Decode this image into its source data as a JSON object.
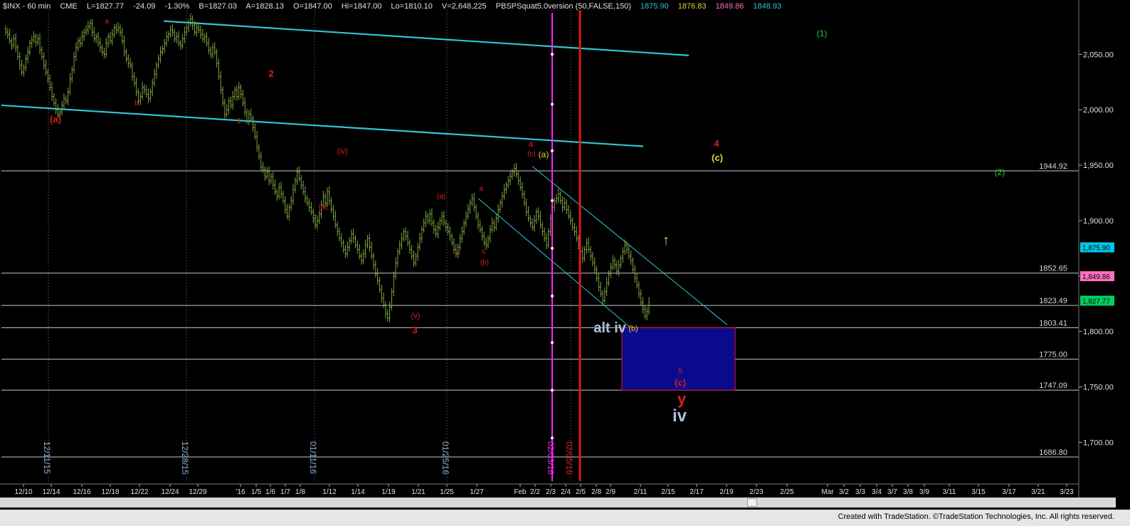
{
  "header": {
    "symbol": "$INX - 60 min",
    "exchange": "CME",
    "last": "L=1827.77",
    "change": "-24.09",
    "change_pct": "-1.30%",
    "bid": "B=1827.03",
    "ask": "A=1828.13",
    "open": "O=1847.00",
    "high": "Hi=1847.00",
    "low": "Lo=1810.10",
    "volume": "V=2,648,225",
    "study": "PBSPSquat5.0version (50,FALSE,150)",
    "study_v1": "1875.90",
    "study_v2": "1876.83",
    "study_v3": "1849.86",
    "study_v4": "1848.93"
  },
  "footer": {
    "credit": "Created with TradeStation. ©TradeStation Technologies, Inc. All rights reserved."
  },
  "colors": {
    "background": "#000000",
    "candle": "#7fa63e",
    "channel": "#2ec4d6",
    "hline": "#c8c8c8",
    "wave_red": "#d62020",
    "wave_yellow": "#e8d23a",
    "wave_green": "#2ecc2e",
    "wave_blue": "#aebfd9",
    "magenta": "#ff22ff",
    "box_fill": "#0a0a8c",
    "box_edge": "#e02020",
    "tag_green": "#00d060",
    "tag_pink": "#ff70c0",
    "tag_cyan": "#00c8e8"
  },
  "chart_data": {
    "type": "candlestick",
    "y_ticks": [
      {
        "value": 2050,
        "label": "2,050.00"
      },
      {
        "value": 2000,
        "label": "2,000.00"
      },
      {
        "value": 1950,
        "label": "1,950.00"
      },
      {
        "value": 1900,
        "label": "1,900.00"
      },
      {
        "value": 1850,
        "label": "1,850.00"
      },
      {
        "value": 1800,
        "label": "1,800.00"
      },
      {
        "value": 1750,
        "label": "1,750.00"
      },
      {
        "value": 1700,
        "label": "1,700.00"
      }
    ],
    "ylim": [
      1665,
      2090
    ],
    "x_ticks": [
      "12/10",
      "12/14",
      "12/16",
      "12/18",
      "12/22",
      "12/24",
      "12/29",
      "'16",
      "1/5",
      "1/6",
      "1/7",
      "1/8",
      "1/12",
      "1/14",
      "1/19",
      "1/21",
      "1/25",
      "1/27",
      "Feb",
      "2/2",
      "2/3",
      "2/4",
      "2/5",
      "2/8",
      "2/9",
      "2/11",
      "2/15",
      "2/17",
      "2/19",
      "2/23",
      "2/25",
      "Mar",
      "3/2",
      "3/3",
      "3/4",
      "3/7",
      "3/8",
      "3/9",
      "3/11",
      "3/15",
      "3/17",
      "3/21",
      "3/23"
    ],
    "vertical_date_labels": [
      "12/11/15",
      "12/28/15",
      "01/11/16",
      "01/25/16",
      "02/03/16",
      "02/05/16"
    ],
    "horizontal_levels": [
      {
        "value": 1944.92,
        "label": "1944.92"
      },
      {
        "value": 1852.65,
        "label": "1852.65"
      },
      {
        "value": 1823.49,
        "label": "1823.49"
      },
      {
        "value": 1803.41,
        "label": "1803.41"
      },
      {
        "value": 1775.0,
        "label": "1775.00"
      },
      {
        "value": 1747.09,
        "label": "1747.09"
      },
      {
        "value": 1686.8,
        "label": "1686.80"
      }
    ],
    "price_tags": [
      {
        "value": 1875.9,
        "label": "1,875.90",
        "color": "tag_cyan"
      },
      {
        "value": 1849.86,
        "label": "1,849.86",
        "color": "tag_pink"
      },
      {
        "value": 1827.77,
        "label": "1,827.77",
        "color": "tag_green"
      }
    ],
    "closes": [
      2070,
      2068,
      2062,
      2058,
      2064,
      2056,
      2048,
      2040,
      2034,
      2038,
      2046,
      2052,
      2060,
      2063,
      2066,
      2061,
      2064,
      2054,
      2048,
      2040,
      2034,
      2028,
      2020,
      2012,
      2006,
      2000,
      1996,
      1998,
      2004,
      2010,
      2008,
      2016,
      2028,
      2036,
      2048,
      2056,
      2062,
      2060,
      2066,
      2070,
      2072,
      2075,
      2078,
      2070,
      2064,
      2066,
      2060,
      2056,
      2052,
      2050,
      2060,
      2066,
      2062,
      2068,
      2074,
      2072,
      2074,
      2070,
      2062,
      2052,
      2046,
      2042,
      2040,
      2030,
      2024,
      2016,
      2008,
      2012,
      2020,
      2018,
      2014,
      2010,
      2016,
      2024,
      2032,
      2040,
      2046,
      2052,
      2055,
      2060,
      2066,
      2068,
      2072,
      2070,
      2064,
      2066,
      2060,
      2058,
      2064,
      2070,
      2074,
      2078,
      2082,
      2076,
      2070,
      2074,
      2072,
      2068,
      2064,
      2066,
      2060,
      2054,
      2050,
      2056,
      2052,
      2042,
      2030,
      2018,
      2006,
      1996,
      2000,
      2008,
      2004,
      2012,
      2018,
      2012,
      2020,
      2014,
      2006,
      1998,
      1990,
      1996,
      1992,
      1984,
      1976,
      1966,
      1958,
      1948,
      1946,
      1940,
      1944,
      1936,
      1940,
      1932,
      1926,
      1922,
      1930,
      1924,
      1918,
      1910,
      1904,
      1912,
      1918,
      1928,
      1936,
      1944,
      1938,
      1932,
      1926,
      1920,
      1916,
      1912,
      1908,
      1902,
      1896,
      1900,
      1906,
      1914,
      1922,
      1916,
      1926,
      1918,
      1910,
      1904,
      1896,
      1890,
      1884,
      1880,
      1874,
      1870,
      1876,
      1882,
      1888,
      1884,
      1878,
      1874,
      1868,
      1864,
      1870,
      1878,
      1884,
      1876,
      1868,
      1860,
      1852,
      1846,
      1838,
      1830,
      1824,
      1816,
      1812,
      1822,
      1836,
      1850,
      1862,
      1872,
      1878,
      1884,
      1890,
      1886,
      1880,
      1874,
      1868,
      1862,
      1868,
      1876,
      1884,
      1892,
      1898,
      1904,
      1900,
      1906,
      1898,
      1892,
      1888,
      1894,
      1900,
      1904,
      1898,
      1894,
      1890,
      1886,
      1880,
      1874,
      1870,
      1876,
      1884,
      1890,
      1898,
      1904,
      1910,
      1916,
      1920,
      1912,
      1904,
      1896,
      1892,
      1886,
      1880,
      1878,
      1884,
      1892,
      1898,
      1894,
      1902,
      1910,
      1916,
      1922,
      1928,
      1932,
      1936,
      1940,
      1944,
      1947,
      1942,
      1936,
      1930,
      1924,
      1916,
      1908,
      1902,
      1898,
      1894,
      1900,
      1908,
      1904,
      1896,
      1890,
      1884,
      1878,
      1890,
      1902,
      1912,
      1918,
      1920,
      1924,
      1918,
      1912,
      1916,
      1910,
      1904,
      1900,
      1894,
      1890,
      1884,
      1878,
      1872,
      1866,
      1874,
      1880,
      1874,
      1868,
      1862,
      1856,
      1848,
      1840,
      1834,
      1828,
      1836,
      1844,
      1852,
      1858,
      1864,
      1860,
      1854,
      1860,
      1866,
      1872,
      1878,
      1874,
      1868,
      1864,
      1856,
      1848,
      1842,
      1834,
      1826,
      1820,
      1814,
      1818,
      1826
    ]
  },
  "annotations": [
    {
      "text": "a",
      "color": "wave_red"
    },
    {
      "text": "(a)",
      "color": "wave_red"
    },
    {
      "text": "b",
      "color": "wave_red"
    },
    {
      "text": "1",
      "color": "wave_red"
    },
    {
      "text": "2",
      "color": "wave_red"
    },
    {
      "text": "(iv)",
      "color": "wave_red"
    },
    {
      "text": "(iii)",
      "color": "wave_red"
    },
    {
      "text": "(v)",
      "color": "wave_red"
    },
    {
      "text": "3",
      "color": "wave_red"
    },
    {
      "text": "(a)",
      "color": "wave_red"
    },
    {
      "text": "a",
      "color": "wave_red"
    },
    {
      "text": "a",
      "color": "wave_red"
    },
    {
      "text": "c",
      "color": "wave_red"
    },
    {
      "text": "(b)",
      "color": "wave_red"
    },
    {
      "text": "4",
      "color": "wave_red"
    },
    {
      "text": "(c)",
      "color": "wave_red"
    },
    {
      "text": "(a)",
      "color": "wave_yellow"
    },
    {
      "text": "alt iv",
      "color": "wave_blue"
    },
    {
      "text": "(b)",
      "color": "wave_yellow"
    },
    {
      "text": "5",
      "color": "wave_red"
    },
    {
      "text": "(c)",
      "color": "wave_red"
    },
    {
      "text": "y",
      "color": "wave_red"
    },
    {
      "text": "iv",
      "color": "wave_blue"
    },
    {
      "text": "4",
      "color": "wave_red"
    },
    {
      "text": "(c)",
      "color": "wave_yellow"
    },
    {
      "text": "(1)",
      "color": "wave_green"
    },
    {
      "text": "(2)",
      "color": "wave_green"
    },
    {
      "text": "↑",
      "color": "wave_yellow"
    }
  ]
}
